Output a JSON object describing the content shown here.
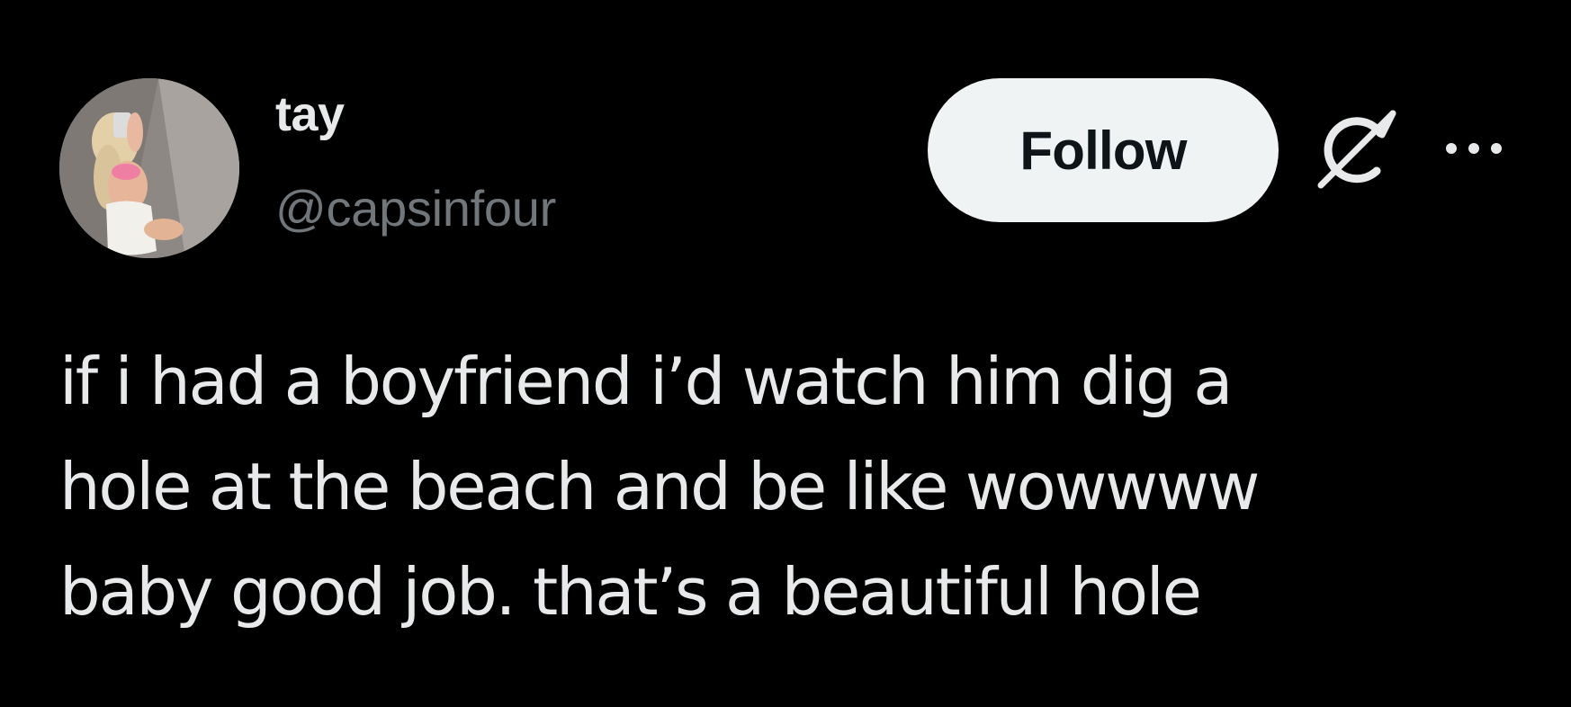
{
  "author": {
    "display_name": "tay",
    "handle": "@capsinfour",
    "avatar_alt": "profile photo"
  },
  "actions": {
    "follow_label": "Follow",
    "grok_icon": "grok-icon",
    "more_icon": "more-horizontal-icon"
  },
  "tweet": {
    "lines": [
      "if i had a boyfriend i’d watch him dig a",
      "hole at the beach and be like wowwww",
      "baby good job. that’s a beautiful hole"
    ]
  },
  "colors": {
    "background": "#000000",
    "text_primary": "#e7e9ea",
    "text_secondary": "#71767b",
    "follow_bg": "#eff3f4",
    "follow_text": "#0f1419"
  }
}
